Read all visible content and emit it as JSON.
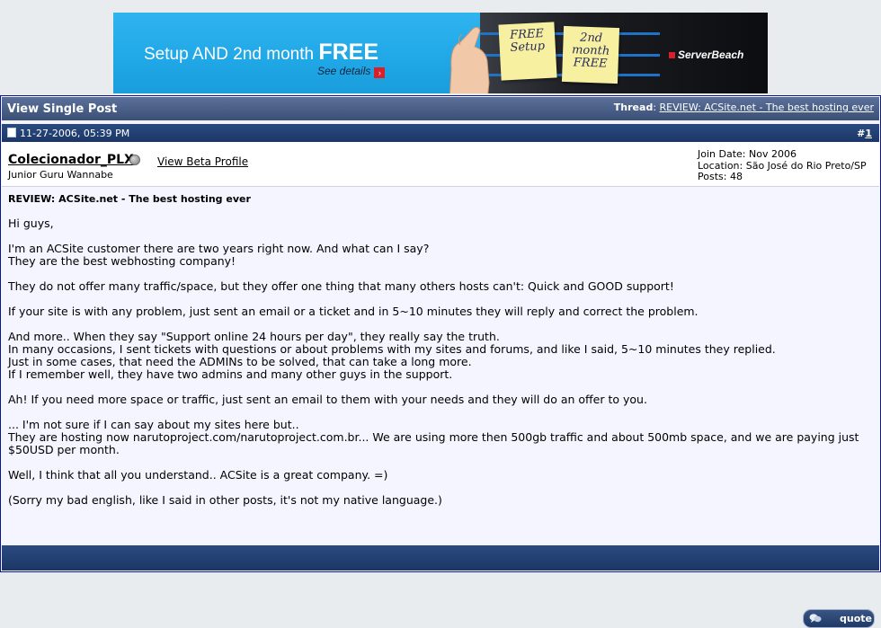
{
  "banner": {
    "headline_prefix": "Setup AND 2nd month ",
    "headline_free": "FREE",
    "details_label": "See details",
    "note1_text": "FREE Setup",
    "note2_text": "2nd month FREE",
    "brand": "ServerBeach",
    "colors": {
      "sky": "#20a7e6",
      "accent_red": "#d8202a"
    }
  },
  "header": {
    "title": "View Single Post",
    "thread_label": "Thread",
    "thread_link": "REVIEW: ACSite.net - The best hosting ever"
  },
  "post": {
    "date": "11-27-2006, 05:39 PM",
    "number_prefix": "#",
    "number": "1",
    "user": {
      "name": "Colecionador_PLX",
      "title": "Junior Guru Wannabe",
      "profile_link": "View Beta Profile",
      "join_date": "Join Date: Nov 2006",
      "location": "Location: São José do Rio Preto/SP",
      "posts": "Posts: 48"
    },
    "title": "REVIEW: ACSite.net - The best hosting ever",
    "paragraphs": [
      [
        "Hi guys,"
      ],
      [
        "I'm an ACSite customer there are two years right now. And what can I say?",
        "They are the best webhosting company!"
      ],
      [
        "They do not offer many traffic/space, but they offer one thing that many others hosts can't: Quick and GOOD support!"
      ],
      [
        "If your site is with any problem, just sent an email or a ticket and in 5~10 minutes they will reply and correct the problem."
      ],
      [
        "And more.. When they say \"Support online 24 hours per day\", they really say the truth.",
        "In many occasions, I sent tickets with questions or about problems with my sites and forums, and like I said, 5~10 minutes they replied.",
        "Just in some cases, that need the ADMINs to be solved, that can take a long more.",
        "If I remember well, they have two admins and many other guys in the support."
      ],
      [
        "Ah! If you need more space or traffic, just sent an email to them with your needs and they will do an offer to you."
      ],
      [
        "... I'm not sure if I can say about my sites here but..",
        "They are hosting now narutoproject.com/narutoproject.com.br... We are using more then 500gb traffic and about 500mb space, and we are paying just",
        "$50USD per month."
      ],
      [
        "Well, I think that all you understand.. ACSite is a great company. =)"
      ],
      [
        "(Sorry my bad english, like I said in other posts, it's not my native language.)"
      ]
    ],
    "quote_label": "quote"
  }
}
